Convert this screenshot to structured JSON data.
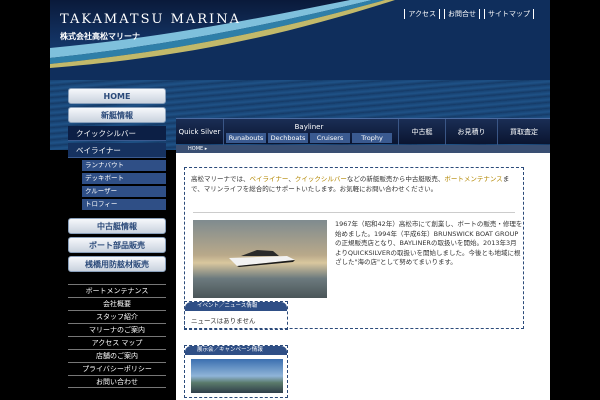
{
  "header": {
    "brand": "TAKAMATSU MARINA",
    "brand_sub": "株式会社高松マリーナ",
    "toplinks": [
      "アクセス",
      "お問合せ",
      "サイトマップ"
    ]
  },
  "leftnav": {
    "home": "HOME",
    "new_boats": "新艇情報",
    "quicksilver": "クイックシルバー",
    "bayliner": "ベイライナー",
    "bayliner_sub": [
      "ランナバウト",
      "デッキボート",
      "クルーザー",
      "トロフィー"
    ],
    "used_boats": "中古艇情報",
    "parts": "ボート部品販売",
    "pier": "桟橋用防舷材販売"
  },
  "leftlinks": [
    "ボートメンテナンス",
    "会社概要",
    "スタッフ紹介",
    "マリーナのご案内",
    "アクセス マップ",
    "店舗のご案内",
    "プライバシーポリシー",
    "お問い合わせ"
  ],
  "mainnav": {
    "quicksilver": "Quick Silver",
    "bayliner": "Bayliner",
    "bayliner_tabs": [
      "Runabouts",
      "Dechboats",
      "Cruisers",
      "Trophy"
    ],
    "used": "中古艇",
    "estimate": "お見積り",
    "appraisal": "買取査定"
  },
  "breadcrumb": "HOME ▸",
  "content": {
    "intro_a": "高松マリーナでは、",
    "intro_hl1": "ベイライナー",
    "intro_b": "、",
    "intro_hl2": "クイックシルバー",
    "intro_c": "などの新艇販売から中古艇販売、",
    "intro_hl3": "ボートメンテナンス",
    "intro_d": "まで、マリンライフを総合的にサポートいたします。お気軽にお問い合わせください。",
    "history": "1967年（昭和42年）高松市にて創業し、ボートの販売・修理を始めました。1994年（平成6年）BRUNSWICK BOAT GROUPの正規販売店となり、BAYLINERの取扱いを開始。2013年3月よりQUICKSILVERの取扱いを開始しました。今後とも地域に根ざした\"海の店\"として努めてまいります。",
    "news_title": "イベント／ニュース情報",
    "news_item": "ニュースはありません",
    "campaign_title": "展示会／キャンペーン情報"
  }
}
